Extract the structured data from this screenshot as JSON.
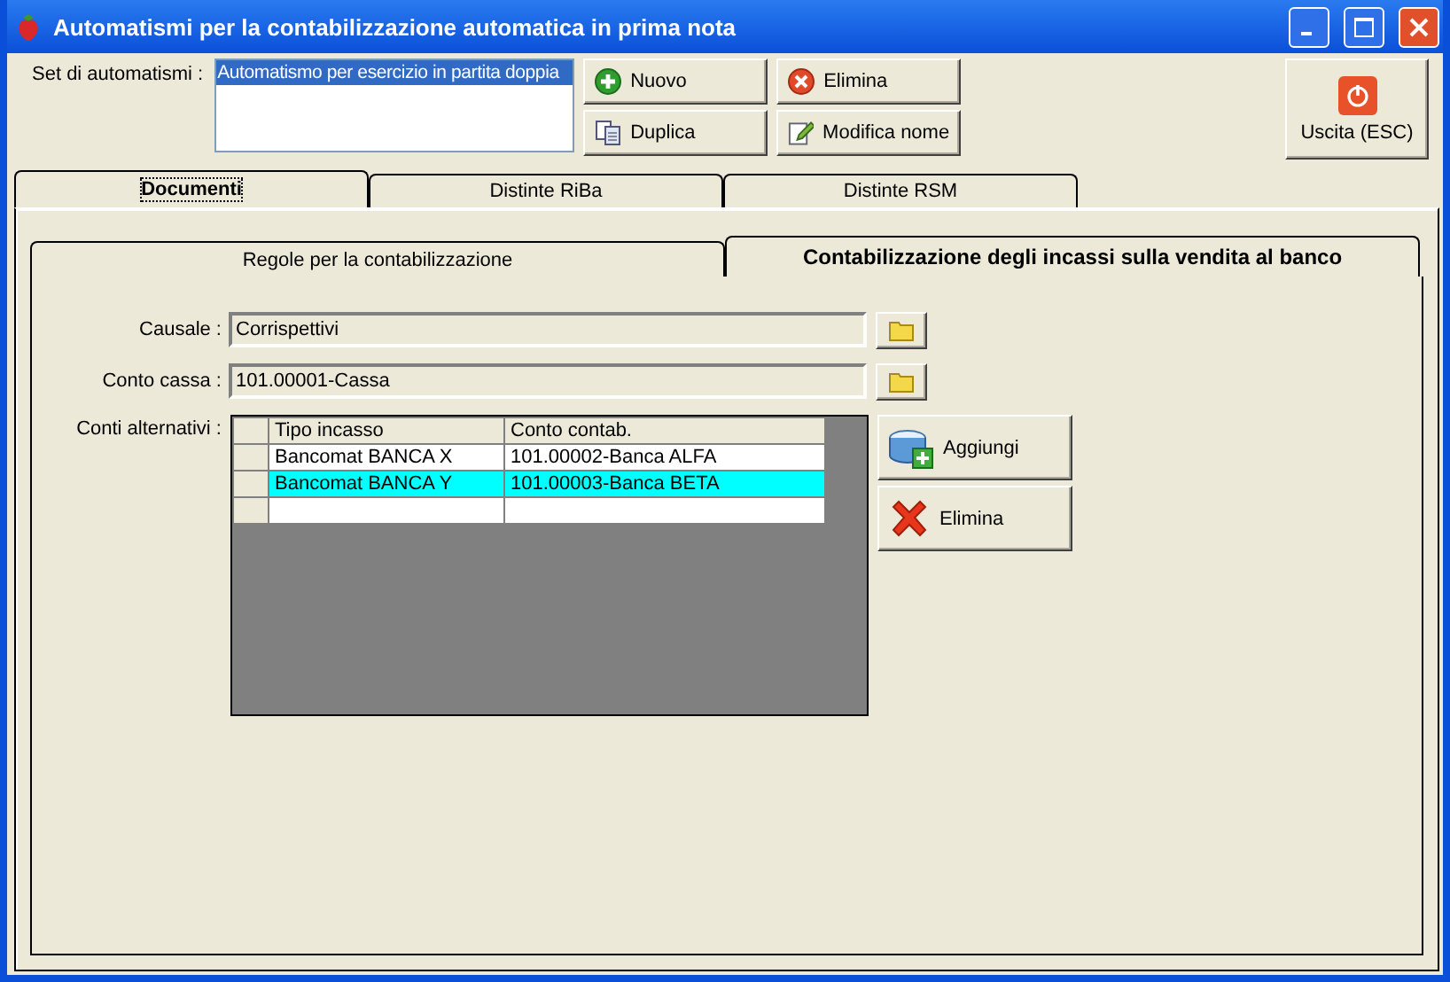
{
  "window": {
    "title": "Automatismi per la contabilizzazione automatica in prima nota"
  },
  "set": {
    "label": "Set di automatismi :",
    "items": [
      {
        "text": "Automatismo per esercizio in partita doppia",
        "selected": true
      }
    ]
  },
  "actions": [
    {
      "label": "Nuovo",
      "kind": "add"
    },
    {
      "label": "Elimina",
      "kind": "delete"
    },
    {
      "label": "Duplica",
      "kind": "copy"
    },
    {
      "label": "Modifica nome",
      "kind": "edit"
    }
  ],
  "exit_button": {
    "label": "Uscita (ESC)"
  },
  "tabs": [
    {
      "label": "Documenti",
      "selected": true
    },
    {
      "label": "Distinte RiBa",
      "selected": false
    },
    {
      "label": "Distinte RSM",
      "selected": false
    }
  ],
  "subtabs": [
    {
      "label": "Regole per la contabilizzazione",
      "selected": false
    },
    {
      "label": "Contabilizzazione degli incassi sulla vendita al banco",
      "selected": true
    }
  ],
  "fields": [
    {
      "label": "Causale :",
      "value": "Corrispettivi"
    },
    {
      "label": "Conto cassa :",
      "value": "101.00001-Cassa"
    }
  ],
  "grid": {
    "label": "Conti alternativi :",
    "columns": [
      "Tipo incasso",
      "Conto contab."
    ],
    "rows": [
      {
        "cells": [
          "Bancomat BANCA X",
          "101.00002-Banca ALFA"
        ],
        "selected": false
      },
      {
        "cells": [
          "Bancomat BANCA Y",
          "101.00003-Banca BETA"
        ],
        "selected": true
      }
    ]
  },
  "grid_buttons": [
    {
      "label": "Aggiungi",
      "kind": "add"
    },
    {
      "label": "Elimina",
      "kind": "delete"
    }
  ]
}
